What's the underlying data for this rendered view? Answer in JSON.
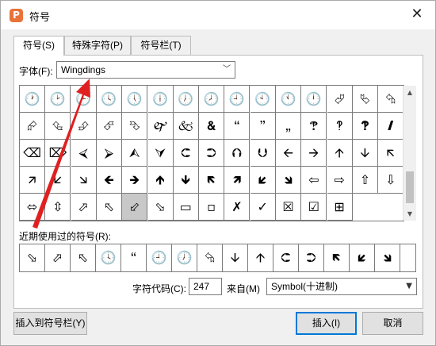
{
  "window": {
    "title": "符号",
    "app_icon_letter": "P",
    "close_glyph": "✕"
  },
  "tabs": [
    {
      "label": "符号(S)",
      "active": true
    },
    {
      "label": "特殊字符(P)",
      "active": false
    },
    {
      "label": "符号栏(T)",
      "active": false
    }
  ],
  "font": {
    "label": "字体(F):",
    "value": "Wingdings"
  },
  "grid": {
    "rows": [
      [
        "🕐",
        "🕑",
        "🕒",
        "🕓",
        "🕔",
        "🕕",
        "🕖",
        "🕗",
        "🕘",
        "🕙",
        "🕚",
        "🕛",
        "⮰",
        "⮱",
        "⮲"
      ],
      [
        "⮳",
        "⮴",
        "⮵",
        "⮶",
        "⮷",
        "🙰",
        "🙵",
        "🙴",
        "🙶",
        "🙷",
        "🙸",
        "🙹",
        "🙺",
        "🙻",
        "🙼"
      ],
      [
        "⌫",
        "⌦",
        "⮘",
        "⮚",
        "⮙",
        "⮛",
        "⮈",
        "⮊",
        "⮉",
        "⮋",
        "🡨",
        "🡪",
        "🡩",
        "🡫",
        "🡬"
      ],
      [
        "🡭",
        "🡯",
        "🡮",
        "🡸",
        "🡺",
        "🡹",
        "🡻",
        "🡼",
        "🡽",
        "🡿",
        "🡾",
        "⇦",
        "⇨",
        "⇧",
        "⇩"
      ],
      [
        "⬄",
        "⇳",
        "⬀",
        "⬁",
        "⬃",
        "⬂",
        "▭",
        "▫",
        "✗",
        "✓",
        "☒",
        "☑",
        "⊞"
      ]
    ],
    "selected_label": "⬃"
  },
  "recent": {
    "label": "近期使用过的符号(R):",
    "items": [
      "⬂",
      "⬀",
      "⬁",
      "🕓",
      "🙶",
      "🕘",
      "🕖",
      "⮲",
      "🡫",
      "🡩",
      "⮈",
      "⮊",
      "🡼",
      "🡿",
      "🡾"
    ]
  },
  "charcode": {
    "label": "字符代码(C):",
    "value": "247",
    "from_label": "来自(M)",
    "from_value": "Symbol(十进制)"
  },
  "buttons": {
    "insert_to_bar": "插入到符号栏(Y)",
    "insert": "插入(I)",
    "cancel": "取消"
  },
  "colors": {
    "annotation_red": "#e02020",
    "focus_blue": "#0078d7"
  }
}
